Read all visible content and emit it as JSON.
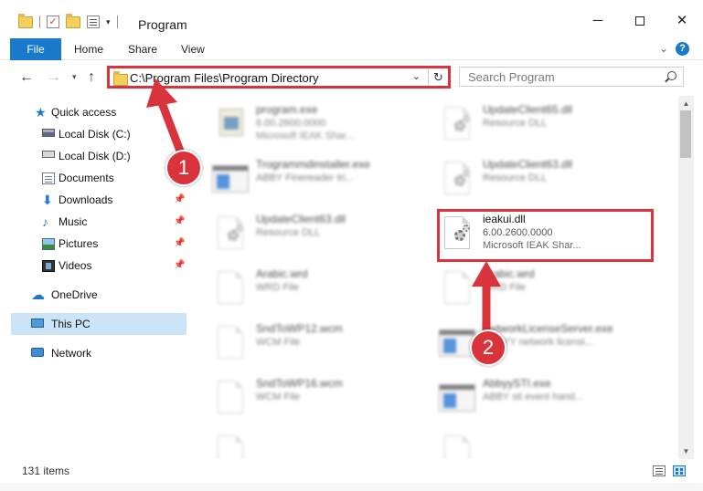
{
  "window": {
    "title": "Program",
    "controls": {
      "minimize": "─",
      "close": "✕"
    }
  },
  "ribbon": {
    "file": "File",
    "tabs": [
      "Home",
      "Share",
      "View"
    ],
    "help": "?"
  },
  "address": {
    "path": "C:\\Program Files\\Program Directory",
    "search_placeholder": "Search Program"
  },
  "sidebar": {
    "items": [
      {
        "label": "Quick access",
        "icon": "quick-access-star-icon",
        "pinned": false
      },
      {
        "label": "Local Disk (C:)",
        "icon": "local-disk-icon",
        "pinned": false
      },
      {
        "label": "Local Disk (D:)",
        "icon": "local-disk-icon",
        "pinned": false
      },
      {
        "label": "Documents",
        "icon": "documents-icon",
        "pinned": true
      },
      {
        "label": "Downloads",
        "icon": "downloads-icon",
        "pinned": true
      },
      {
        "label": "Music",
        "icon": "music-icon",
        "pinned": true
      },
      {
        "label": "Pictures",
        "icon": "pictures-icon",
        "pinned": true
      },
      {
        "label": "Videos",
        "icon": "videos-icon",
        "pinned": true
      },
      {
        "label": "OneDrive",
        "icon": "onedrive-cloud-icon",
        "pinned": false
      },
      {
        "label": "This PC",
        "icon": "this-pc-icon",
        "pinned": false,
        "selected": true
      },
      {
        "label": "Network",
        "icon": "network-icon",
        "pinned": false
      }
    ]
  },
  "files": [
    {
      "name": "program.exe",
      "line2": "6.00.2600.0000",
      "line3": "Microsoft IEAK Shar...",
      "type": "exe-prog",
      "col": 0,
      "row": 0,
      "blurred": true
    },
    {
      "name": "UpdateClient65.dll",
      "line2": "Resource DLL",
      "line3": "",
      "type": "dll",
      "col": 1,
      "row": 0,
      "blurred": true
    },
    {
      "name": "Trogrammdinstaller.exe",
      "line2": "ABBY Finereader tri...",
      "line3": "",
      "type": "exe-win",
      "col": 0,
      "row": 1,
      "blurred": true
    },
    {
      "name": "UpdateClient63.dll",
      "line2": "Resource DLL",
      "line3": "",
      "type": "dll",
      "col": 1,
      "row": 1,
      "blurred": true
    },
    {
      "name": "UpdateClient63.dll",
      "line2": "Resource DLL",
      "line3": "",
      "type": "dll",
      "col": 0,
      "row": 2,
      "blurred": true
    },
    {
      "name": "ieakui.dll",
      "line2": "6.00.2600.0000",
      "line3": "Microsoft IEAK Shar...",
      "type": "dll",
      "col": 1,
      "row": 2,
      "blurred": false
    },
    {
      "name": "Arabic.wrd",
      "line2": "WRD File",
      "line3": "",
      "type": "doc",
      "col": 0,
      "row": 3,
      "blurred": true
    },
    {
      "name": "Arabic.wrd",
      "line2": "WRD File",
      "line3": "",
      "type": "doc",
      "col": 1,
      "row": 3,
      "blurred": true
    },
    {
      "name": "SndToWP12.wcm",
      "line2": "WCM File",
      "line3": "",
      "type": "doc",
      "col": 0,
      "row": 4,
      "blurred": true
    },
    {
      "name": "NetworkLicenseServer.exe",
      "line2": "ABBYY network licensi...",
      "line3": "",
      "type": "exe-win",
      "col": 1,
      "row": 4,
      "blurred": true
    },
    {
      "name": "SndToWP16.wcm",
      "line2": "WCM File",
      "line3": "",
      "type": "doc",
      "col": 0,
      "row": 5,
      "blurred": true
    },
    {
      "name": "AbbyySTI.exe",
      "line2": "ABBY sti event hand...",
      "line3": "",
      "type": "exe-win",
      "col": 1,
      "row": 5,
      "blurred": true
    },
    {
      "name": "",
      "line2": "",
      "line3": "",
      "type": "doc",
      "col": 0,
      "row": 6,
      "blurred": true
    },
    {
      "name": "",
      "line2": "",
      "line3": "",
      "type": "doc",
      "col": 1,
      "row": 6,
      "blurred": true
    }
  ],
  "annotations": {
    "badge1": "1",
    "badge2": "2",
    "color": "#d9333c"
  },
  "status": {
    "items_count": "131 items"
  },
  "colors": {
    "accent": "#1979ca",
    "selection": "#cce4f7",
    "annotation": "#d9333c"
  }
}
